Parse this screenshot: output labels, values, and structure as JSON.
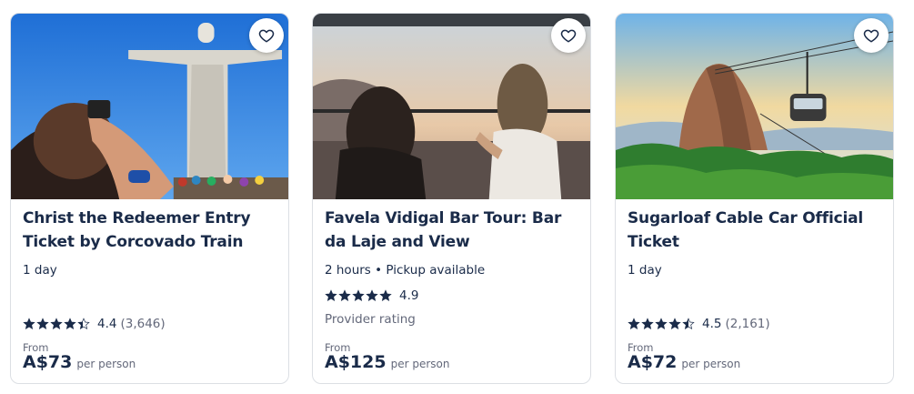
{
  "colors": {
    "text": "#1a2b49",
    "muted": "#63687a",
    "star": "#1a2b49",
    "border": "#dcdfe4"
  },
  "cards": [
    {
      "title": "Christ the Redeemer Entry Ticket by Corcovado Train",
      "meta": "1 day",
      "rating": 4.4,
      "rating_text": "4.4",
      "reviews": "(3,646)",
      "from_label": "From",
      "price": "A$73",
      "per_person": "per person",
      "wishlist_icon": "heart-outline-icon"
    },
    {
      "title": "Favela Vidigal Bar Tour: Bar da Laje and View",
      "meta": "2 hours • Pickup available",
      "rating": 4.9,
      "rating_text": "4.9",
      "provider_rating": "Provider rating",
      "from_label": "From",
      "price": "A$125",
      "per_person": "per person",
      "wishlist_icon": "heart-outline-icon"
    },
    {
      "title": "Sugarloaf Cable Car Official Ticket",
      "meta": "1 day",
      "rating": 4.5,
      "rating_text": "4.5",
      "reviews": "(2,161)",
      "from_label": "From",
      "price": "A$72",
      "per_person": "per person",
      "wishlist_icon": "heart-outline-icon"
    }
  ]
}
